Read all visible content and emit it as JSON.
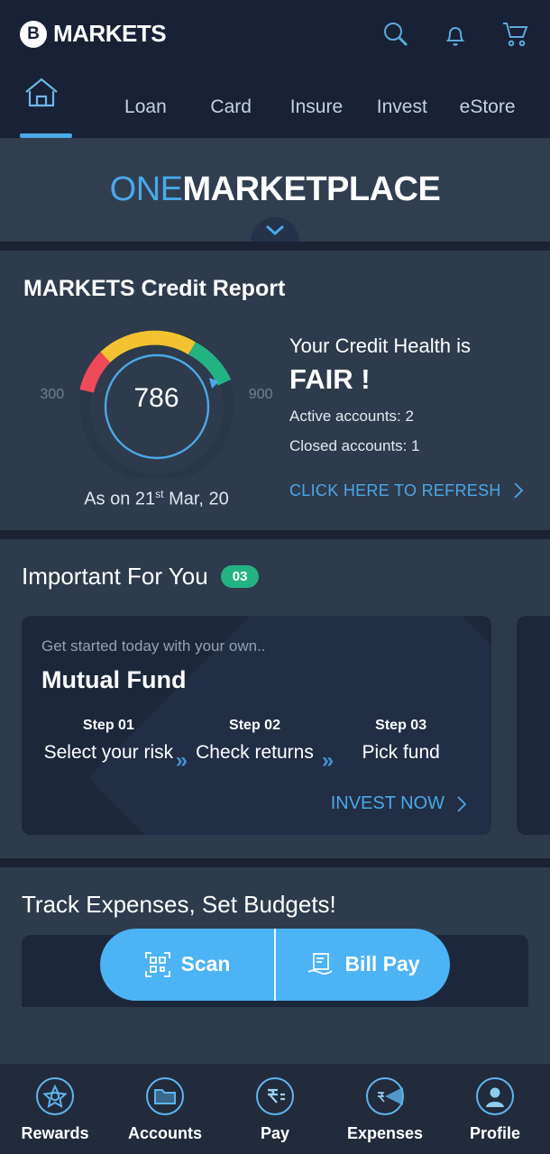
{
  "brand": {
    "logo_letter": "B",
    "name": "MARKETS",
    "accent_blue": "#4aa8e8",
    "accent_green": "#23b383",
    "pill_blue": "#4cb3f5"
  },
  "topbar": {
    "icons": [
      {
        "name": "search-icon",
        "label": "Search"
      },
      {
        "name": "bell-icon",
        "label": "Notifications"
      },
      {
        "name": "cart-icon",
        "label": "Cart"
      }
    ]
  },
  "navtabs": [
    {
      "label": "",
      "name": "home-icon",
      "active": true
    },
    {
      "label": "Loan",
      "active": false
    },
    {
      "label": "Card",
      "active": false
    },
    {
      "label": "Insure",
      "active": false
    },
    {
      "label": "Invest",
      "active": false
    },
    {
      "label": "eStore",
      "active": false
    }
  ],
  "hero": {
    "title_one": "ONE",
    "title_two": "MARKETPLACE",
    "scroll_icon": "chevron-down-icon"
  },
  "credit": {
    "heading": "MARKETS Credit Report",
    "score": "786",
    "scale_min": "300",
    "scale_max": "900",
    "as_on_prefix": "As on 21",
    "as_on_sup": "st",
    "as_on_suffix": " Mar, 20",
    "health_lead": "Your Credit Health is",
    "rating": "FAIR !",
    "active_accounts": "Active accounts: 2",
    "closed_accounts": "Closed accounts: 1",
    "refresh_label": "CLICK HERE TO REFRESH",
    "gauge": {
      "segments": [
        {
          "name": "poor",
          "color": "#ef4a5a",
          "from": 300,
          "to": 450
        },
        {
          "name": "average",
          "color": "#f2c230",
          "from": 450,
          "to": 700
        },
        {
          "name": "good",
          "color": "#23b383",
          "from": 700,
          "to": 800
        },
        {
          "name": "remaining",
          "color": "#2a3749",
          "from": 800,
          "to": 900
        }
      ],
      "needle_value": 786,
      "ring_color": "#4aa8e8"
    }
  },
  "important": {
    "heading": "Important For You",
    "count_badge": "03",
    "cards": [
      {
        "kicker": "Get started today with your own..",
        "title": "Mutual Fund",
        "steps": [
          {
            "no": "Step 01",
            "text": "Select your risk"
          },
          {
            "no": "Step 02",
            "text": "Check returns"
          },
          {
            "no": "Step 03",
            "text": "Pick fund"
          }
        ],
        "cta": "INVEST NOW"
      }
    ]
  },
  "track": {
    "heading": "Track Expenses, Set Budgets!",
    "actions": [
      {
        "label": "Scan",
        "icon": "qr-scan-icon"
      },
      {
        "label": "Bill Pay",
        "icon": "bill-receipt-icon"
      }
    ]
  },
  "bottomnav": [
    {
      "label": "Rewards",
      "icon": "star-badge-icon"
    },
    {
      "label": "Accounts",
      "icon": "folder-icon"
    },
    {
      "label": "Pay",
      "icon": "rupee-icon"
    },
    {
      "label": "Expenses",
      "icon": "pie-chart-rupee-icon"
    },
    {
      "label": "Profile",
      "icon": "user-avatar-icon"
    }
  ]
}
